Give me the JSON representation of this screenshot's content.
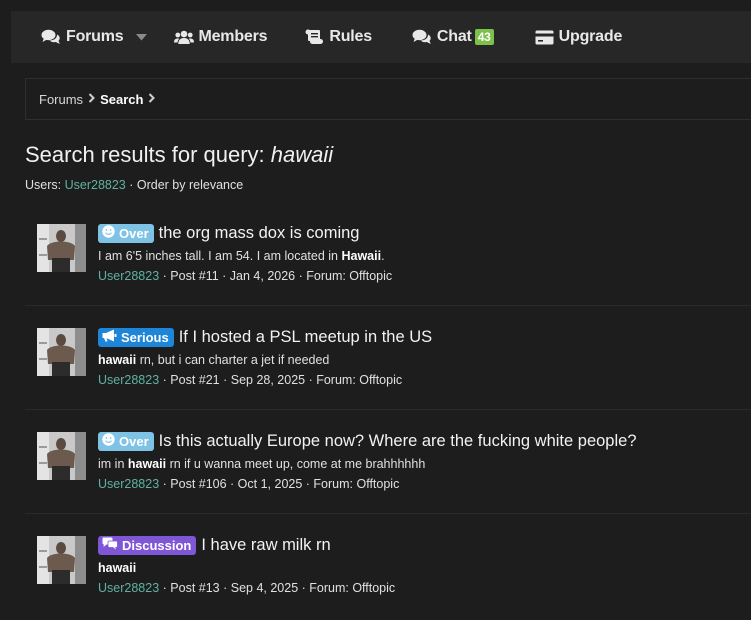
{
  "nav": {
    "forums": "Forums",
    "members": "Members",
    "rules": "Rules",
    "chat": "Chat",
    "chat_count": "43",
    "upgrade": "Upgrade"
  },
  "breadcrumb": {
    "items": [
      "Forums",
      "Search"
    ]
  },
  "title": {
    "prefix": "Search results for query:",
    "query": "hawaii"
  },
  "subtitle": {
    "users_label": "Users:",
    "user": "User28823",
    "order": "· Order by relevance"
  },
  "results": [
    {
      "label": "Over",
      "label_type": "over",
      "title": "the org mass dox is coming",
      "snippet_pre": "I am 6'5 inches tall. I am 54. I am located in ",
      "snippet_bold": "Hawaii",
      "snippet_post": ".",
      "user": "User28823",
      "meta": "· Post #11 · Jan 4, 2026 · Forum: Offtopic"
    },
    {
      "label": "Serious",
      "label_type": "serious",
      "title": "If I hosted a PSL meetup in the US",
      "snippet_pre": "",
      "snippet_bold": "hawaii",
      "snippet_post": " rn, but i can charter a jet if needed",
      "user": "User28823",
      "meta": "· Post #21 · Sep 28, 2025 · Forum: Offtopic"
    },
    {
      "label": "Over",
      "label_type": "over",
      "title": "Is this actually Europe now? Where are the fucking white people?",
      "snippet_pre": "im in ",
      "snippet_bold": "hawaii",
      "snippet_post": " rn if u wanna meet up, come at me brahhhhhh",
      "user": "User28823",
      "meta": "· Post #106 · Oct 1, 2025 · Forum: Offtopic"
    },
    {
      "label": "Discussion",
      "label_type": "discussion",
      "title": "I have raw milk rn",
      "snippet_pre": "",
      "snippet_bold": "hawaii",
      "snippet_post": "",
      "user": "User28823",
      "meta": "· Post #13 · Sep 4, 2025 · Forum: Offtopic"
    }
  ],
  "colors": {
    "label_over": "#7ec3e6",
    "label_serious": "#1d86d9",
    "label_discussion": "#7e56d6",
    "user_link": "#5fb3a0",
    "chat_badge": "#7cc24a"
  }
}
